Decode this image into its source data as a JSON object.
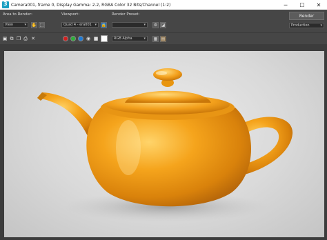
{
  "window": {
    "title": "Camera001, frame 0, Display Gamma: 2.2, RGBA Color 32 Bits/Channel (1:2)",
    "minimize": "─",
    "maximize": "☐",
    "close": "✕"
  },
  "toolbar": {
    "area_label": "Area to Render:",
    "area_value": "View",
    "viewport_label": "Viewport:",
    "viewport_value": "Quad 4 - era001",
    "preset_label": "Render Preset:",
    "preset_value": "",
    "render_button": "Render",
    "mode_value": "Production"
  },
  "toolbar2": {
    "channel_value": "RGB Alpha",
    "channel_colors": [
      "#d21f1f",
      "#2fae3a",
      "#1f7bd6"
    ]
  },
  "colors": {
    "chrome": "#464646",
    "teapot": "#f2a21b",
    "background": "#dcdcdc"
  }
}
